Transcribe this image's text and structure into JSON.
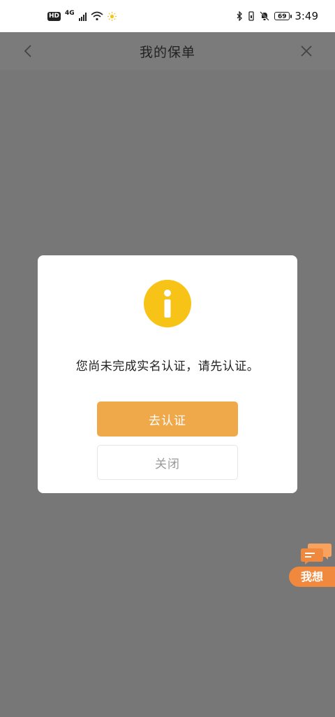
{
  "status_bar": {
    "hd_badge": "HD",
    "network_type": "4G",
    "battery_level": "69",
    "time": "3:49",
    "icons": [
      "hd-icon",
      "signal-icon",
      "wifi-icon",
      "sun-icon",
      "bluetooth-icon",
      "vibrate-icon",
      "mute-icon",
      "battery-icon"
    ]
  },
  "header": {
    "title": "我的保单",
    "back_icon": "chevron-left-icon",
    "close_icon": "close-icon"
  },
  "dialog": {
    "icon": "info-icon",
    "message": "您尚未完成实名认证，请先认证。",
    "primary_button": "去认证",
    "secondary_button": "关闭",
    "colors": {
      "icon_bg": "#f7c316",
      "primary_bg": "#f0a94a"
    }
  },
  "float_widget": {
    "label": "我想",
    "icon": "chat-bubble-icon",
    "color": "#f0893d"
  }
}
